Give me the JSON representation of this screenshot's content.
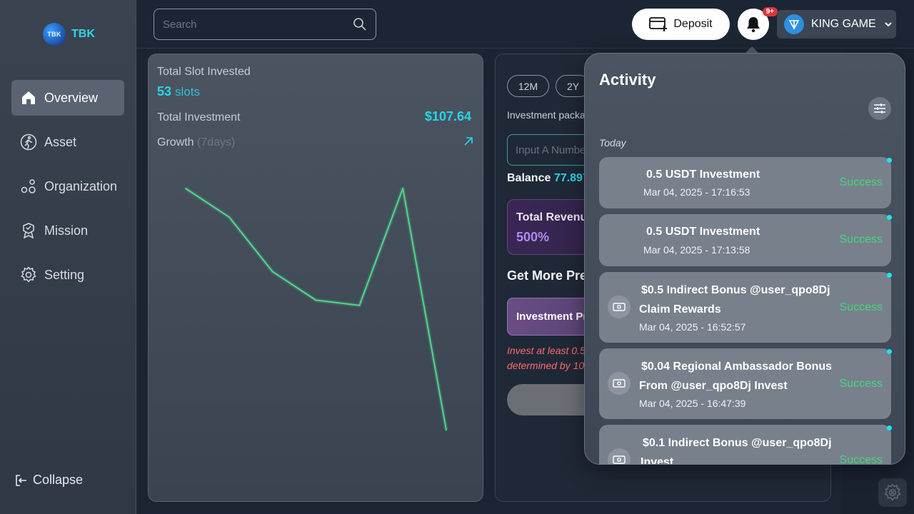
{
  "brand": {
    "logo_badge": "TBK",
    "name": "TBK",
    "accent": "#25d6e6"
  },
  "sidebar": {
    "items": [
      {
        "label": "Overview",
        "icon": "home-icon",
        "active": true
      },
      {
        "label": "Asset",
        "icon": "person-walk-icon",
        "active": false
      },
      {
        "label": "Organization",
        "icon": "organization-icon",
        "active": false
      },
      {
        "label": "Mission",
        "icon": "medal-icon",
        "active": false
      },
      {
        "label": "Setting",
        "icon": "gear-icon",
        "active": false
      }
    ],
    "collapse_label": "Collapse"
  },
  "header": {
    "search_placeholder": "Search",
    "deposit_label": "Deposit",
    "notification_badge": "9+",
    "account_name": "KING GAME"
  },
  "summary": {
    "slot_title": "Total Slot Invested",
    "slot_count": "53",
    "slot_unit": "slots",
    "investment_title": "Total Investment",
    "investment_value": "$107.64",
    "growth_title": "Growth",
    "growth_period": "(7days)"
  },
  "chart_data": {
    "type": "line",
    "title": "",
    "xlabel": "",
    "ylabel": "",
    "color": "#4fd88a",
    "values": [
      0.0,
      0.11,
      0.32,
      0.43,
      0.45,
      0.0,
      0.93
    ]
  },
  "invest_panel": {
    "periods": [
      "12M",
      "2Y"
    ],
    "package_label": "Investment packag",
    "input_placeholder": "Input A Numbe",
    "balance_label": "Balance",
    "balance_value": "77.897",
    "revenue_title": "Total Revenue",
    "revenue_value": "500%",
    "more_title": "Get More Pre",
    "premium_label": "Investment Pre",
    "warning_line1": "Invest at least 0.5",
    "warning_line2": "determined by 10"
  },
  "activity": {
    "title": "Activity",
    "section": "Today",
    "items": [
      {
        "line1": "0.5 USDT Investment",
        "line2": "",
        "time": "Mar 04, 2025 - 17:16:53",
        "status": "Success",
        "has_icon": false
      },
      {
        "line1": "0.5 USDT Investment",
        "line2": "",
        "time": "Mar 04, 2025 - 17:13:58",
        "status": "Success",
        "has_icon": false
      },
      {
        "line1": "$0.5 Indirect Bonus @user_qpo8Dj",
        "line2": "Claim Rewards",
        "time": "Mar 04, 2025 - 16:52:57",
        "status": "Success",
        "has_icon": true
      },
      {
        "line1": "$0.04 Regional Ambassador Bonus",
        "line2": "From @user_qpo8Dj Invest",
        "time": "Mar 04, 2025 - 16:47:39",
        "status": "Success",
        "has_icon": true
      },
      {
        "line1": "$0.1 Indirect Bonus @user_qpo8Dj",
        "line2": "Invest",
        "time": "",
        "status": "Success",
        "has_icon": true
      }
    ]
  }
}
